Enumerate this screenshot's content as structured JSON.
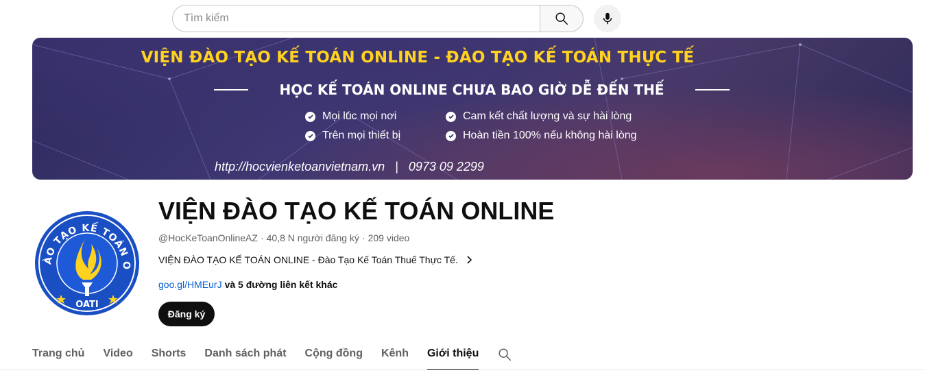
{
  "search": {
    "placeholder": "Tìm kiếm"
  },
  "icons": {
    "search": "search-icon",
    "mic": "mic-icon",
    "chevron": "chevron-right-icon",
    "check": "check-circle-icon"
  },
  "banner": {
    "title": "VIỆN ĐÀO TẠO KẾ TOÁN ONLINE - ĐÀO TẠO KẾ TOÁN THỰC TẾ",
    "subtitle": "HỌC KẾ TOÁN ONLINE CHƯA BAO GIỜ DỄ ĐẾN THẾ",
    "bullets": [
      "Mọi lúc mọi nơi",
      "Trên mọi thiết bị",
      "Cam kết chất lượng và sự hài lòng",
      "Hoàn tiền 100% nếu không hài lòng"
    ],
    "url_line": "http://hocvienketoanvietnam.vn   |   0973 09 2299",
    "colors": {
      "title": "#ffd21f",
      "text": "#ffffff"
    }
  },
  "avatar": {
    "top_text": "VIỆN ĐÀO TẠO KẾ TOÁN ONLINE",
    "bottom_text": "OATI",
    "colors": {
      "ring": "#1a4fc4",
      "flame": "#ffd21f"
    }
  },
  "channel": {
    "name": "VIỆN ĐÀO TẠO KẾ TOÁN ONLINE",
    "handle": "@HocKeToanOnlineAZ",
    "sep1": "·",
    "subscribers": "40,8 N người đăng ký",
    "sep2": "·",
    "videos": "209 video",
    "description": "VIỆN ĐÀO TẠO KẾ TOÁN ONLINE - Đào Tạo Kế Toán Thuế Thực Tế.",
    "link": "goo.gl/HMEurJ",
    "link_more": "và 5 đường liên kết khác",
    "subscribe_label": "Đăng ký"
  },
  "tabs": [
    {
      "label": "Trang chủ",
      "active": false
    },
    {
      "label": "Video",
      "active": false
    },
    {
      "label": "Shorts",
      "active": false
    },
    {
      "label": "Danh sách phát",
      "active": false
    },
    {
      "label": "Cộng đồng",
      "active": false
    },
    {
      "label": "Kênh",
      "active": false
    },
    {
      "label": "Giới thiệu",
      "active": true
    }
  ]
}
